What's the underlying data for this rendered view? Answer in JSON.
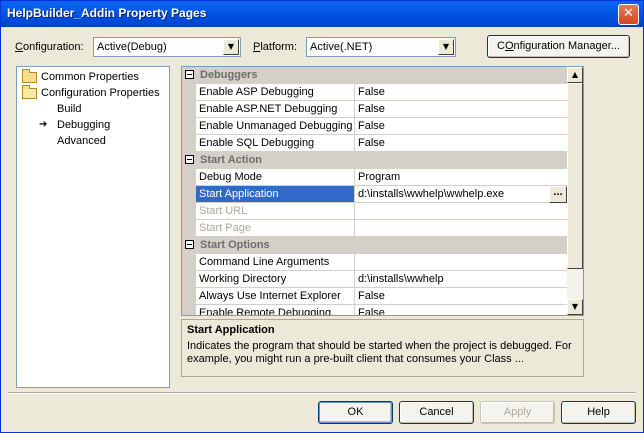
{
  "window": {
    "title": "HelpBuilder_Addin Property Pages"
  },
  "toolbar": {
    "configuration_label_prefix": "",
    "configuration_label_key": "C",
    "configuration_label_rest": "onfiguration:",
    "configuration_value": "Active(Debug)",
    "platform_label_key": "P",
    "platform_label_rest": "latform:",
    "platform_value": "Active(.NET)",
    "config_manager_label_key": "O",
    "config_manager_label_pre": "C",
    "config_manager_label_rest": "nfiguration Manager..."
  },
  "tree": {
    "items": [
      {
        "label": "Common Properties"
      },
      {
        "label": "Configuration Properties"
      },
      {
        "label": "Build"
      },
      {
        "label": "Debugging"
      },
      {
        "label": "Advanced"
      }
    ]
  },
  "grid": {
    "categories": [
      {
        "name": "Debuggers"
      },
      {
        "name": "Start Action"
      },
      {
        "name": "Start Options"
      }
    ],
    "rows": [
      {
        "name": "Enable ASP Debugging",
        "value": "False"
      },
      {
        "name": "Enable ASP.NET Debugging",
        "value": "False"
      },
      {
        "name": "Enable Unmanaged Debugging",
        "value": "False"
      },
      {
        "name": "Enable SQL Debugging",
        "value": "False"
      },
      {
        "name": "Debug Mode",
        "value": "Program"
      },
      {
        "name": "Start Application",
        "value": "d:\\installs\\wwhelp\\wwhelp.exe"
      },
      {
        "name": "Start URL",
        "value": ""
      },
      {
        "name": "Start Page",
        "value": ""
      },
      {
        "name": "Command Line Arguments",
        "value": ""
      },
      {
        "name": "Working Directory",
        "value": "d:\\installs\\wwhelp"
      },
      {
        "name": "Always Use Internet Explorer",
        "value": "False"
      },
      {
        "name": "Enable Remote Debugging",
        "value": "False"
      }
    ],
    "ellipsis": "..."
  },
  "description": {
    "title": "Start Application",
    "text": "Indicates the program that should be started when the project is debugged. For example, you might run a pre-built client that consumes your Class ..."
  },
  "buttons": {
    "ok": "OK",
    "cancel": "Cancel",
    "apply": "Apply",
    "help": "Help"
  }
}
